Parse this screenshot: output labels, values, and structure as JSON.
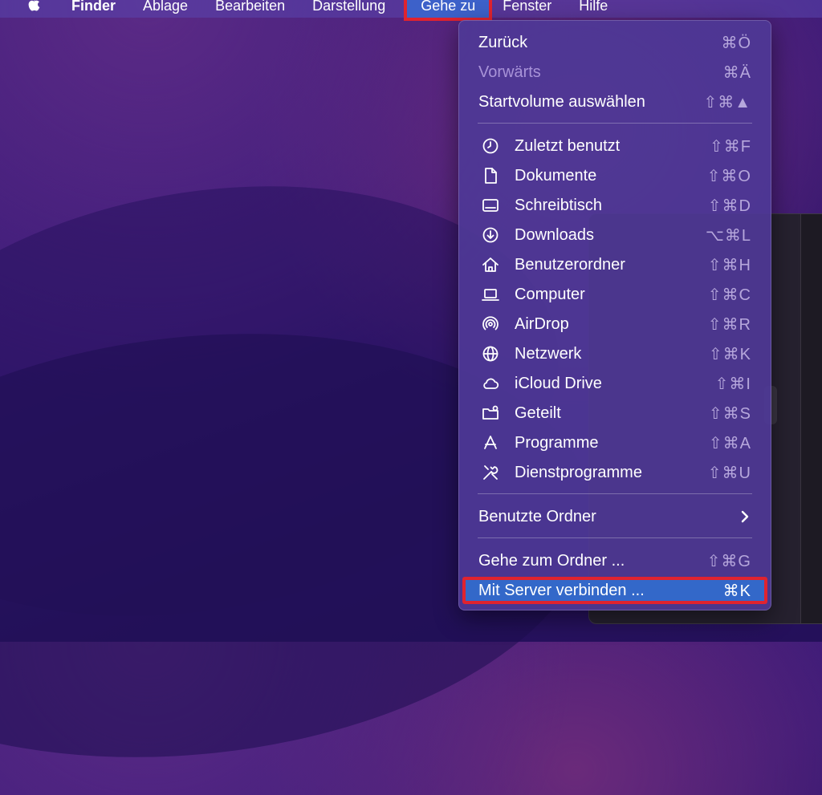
{
  "menubar": {
    "items": [
      "Finder",
      "Ablage",
      "Bearbeiten",
      "Darstellung",
      "Gehe zu",
      "Fenster",
      "Hilfe"
    ],
    "active": "Gehe zu"
  },
  "menu": {
    "top": [
      {
        "label": "Zurück",
        "shortcut": "⌘Ö",
        "enabled": true
      },
      {
        "label": "Vorwärts",
        "shortcut": "⌘Ä",
        "enabled": false
      },
      {
        "label": "Startvolume auswählen",
        "shortcut": "⇧⌘▲",
        "enabled": true
      }
    ],
    "places": [
      {
        "label": "Zuletzt benutzt",
        "shortcut": "⇧⌘F",
        "icon": "clock-icon"
      },
      {
        "label": "Dokumente",
        "shortcut": "⇧⌘O",
        "icon": "document-icon"
      },
      {
        "label": "Schreibtisch",
        "shortcut": "⇧⌘D",
        "icon": "desktop-icon"
      },
      {
        "label": "Downloads",
        "shortcut": "⌥⌘L",
        "icon": "download-icon"
      },
      {
        "label": "Benutzerordner",
        "shortcut": "⇧⌘H",
        "icon": "home-icon"
      },
      {
        "label": "Computer",
        "shortcut": "⇧⌘C",
        "icon": "laptop-icon"
      },
      {
        "label": "AirDrop",
        "shortcut": "⇧⌘R",
        "icon": "airdrop-icon"
      },
      {
        "label": "Netzwerk",
        "shortcut": "⇧⌘K",
        "icon": "globe-icon"
      },
      {
        "label": "iCloud Drive",
        "shortcut": "⇧⌘I",
        "icon": "cloud-icon"
      },
      {
        "label": "Geteilt",
        "shortcut": "⇧⌘S",
        "icon": "shared-folder-icon"
      },
      {
        "label": "Programme",
        "shortcut": "⇧⌘A",
        "icon": "apps-icon"
      },
      {
        "label": "Dienstprogramme",
        "shortcut": "⇧⌘U",
        "icon": "tools-icon"
      }
    ],
    "recent": {
      "label": "Benutzte Ordner"
    },
    "go_folder": {
      "label": "Gehe zum Ordner ...",
      "shortcut": "⇧⌘G"
    },
    "connect": {
      "label": "Mit Server verbinden ...",
      "shortcut": "⌘K",
      "highlighted": true
    }
  },
  "colors": {
    "highlight": "#3368c9",
    "annotation": "#e0232f"
  }
}
